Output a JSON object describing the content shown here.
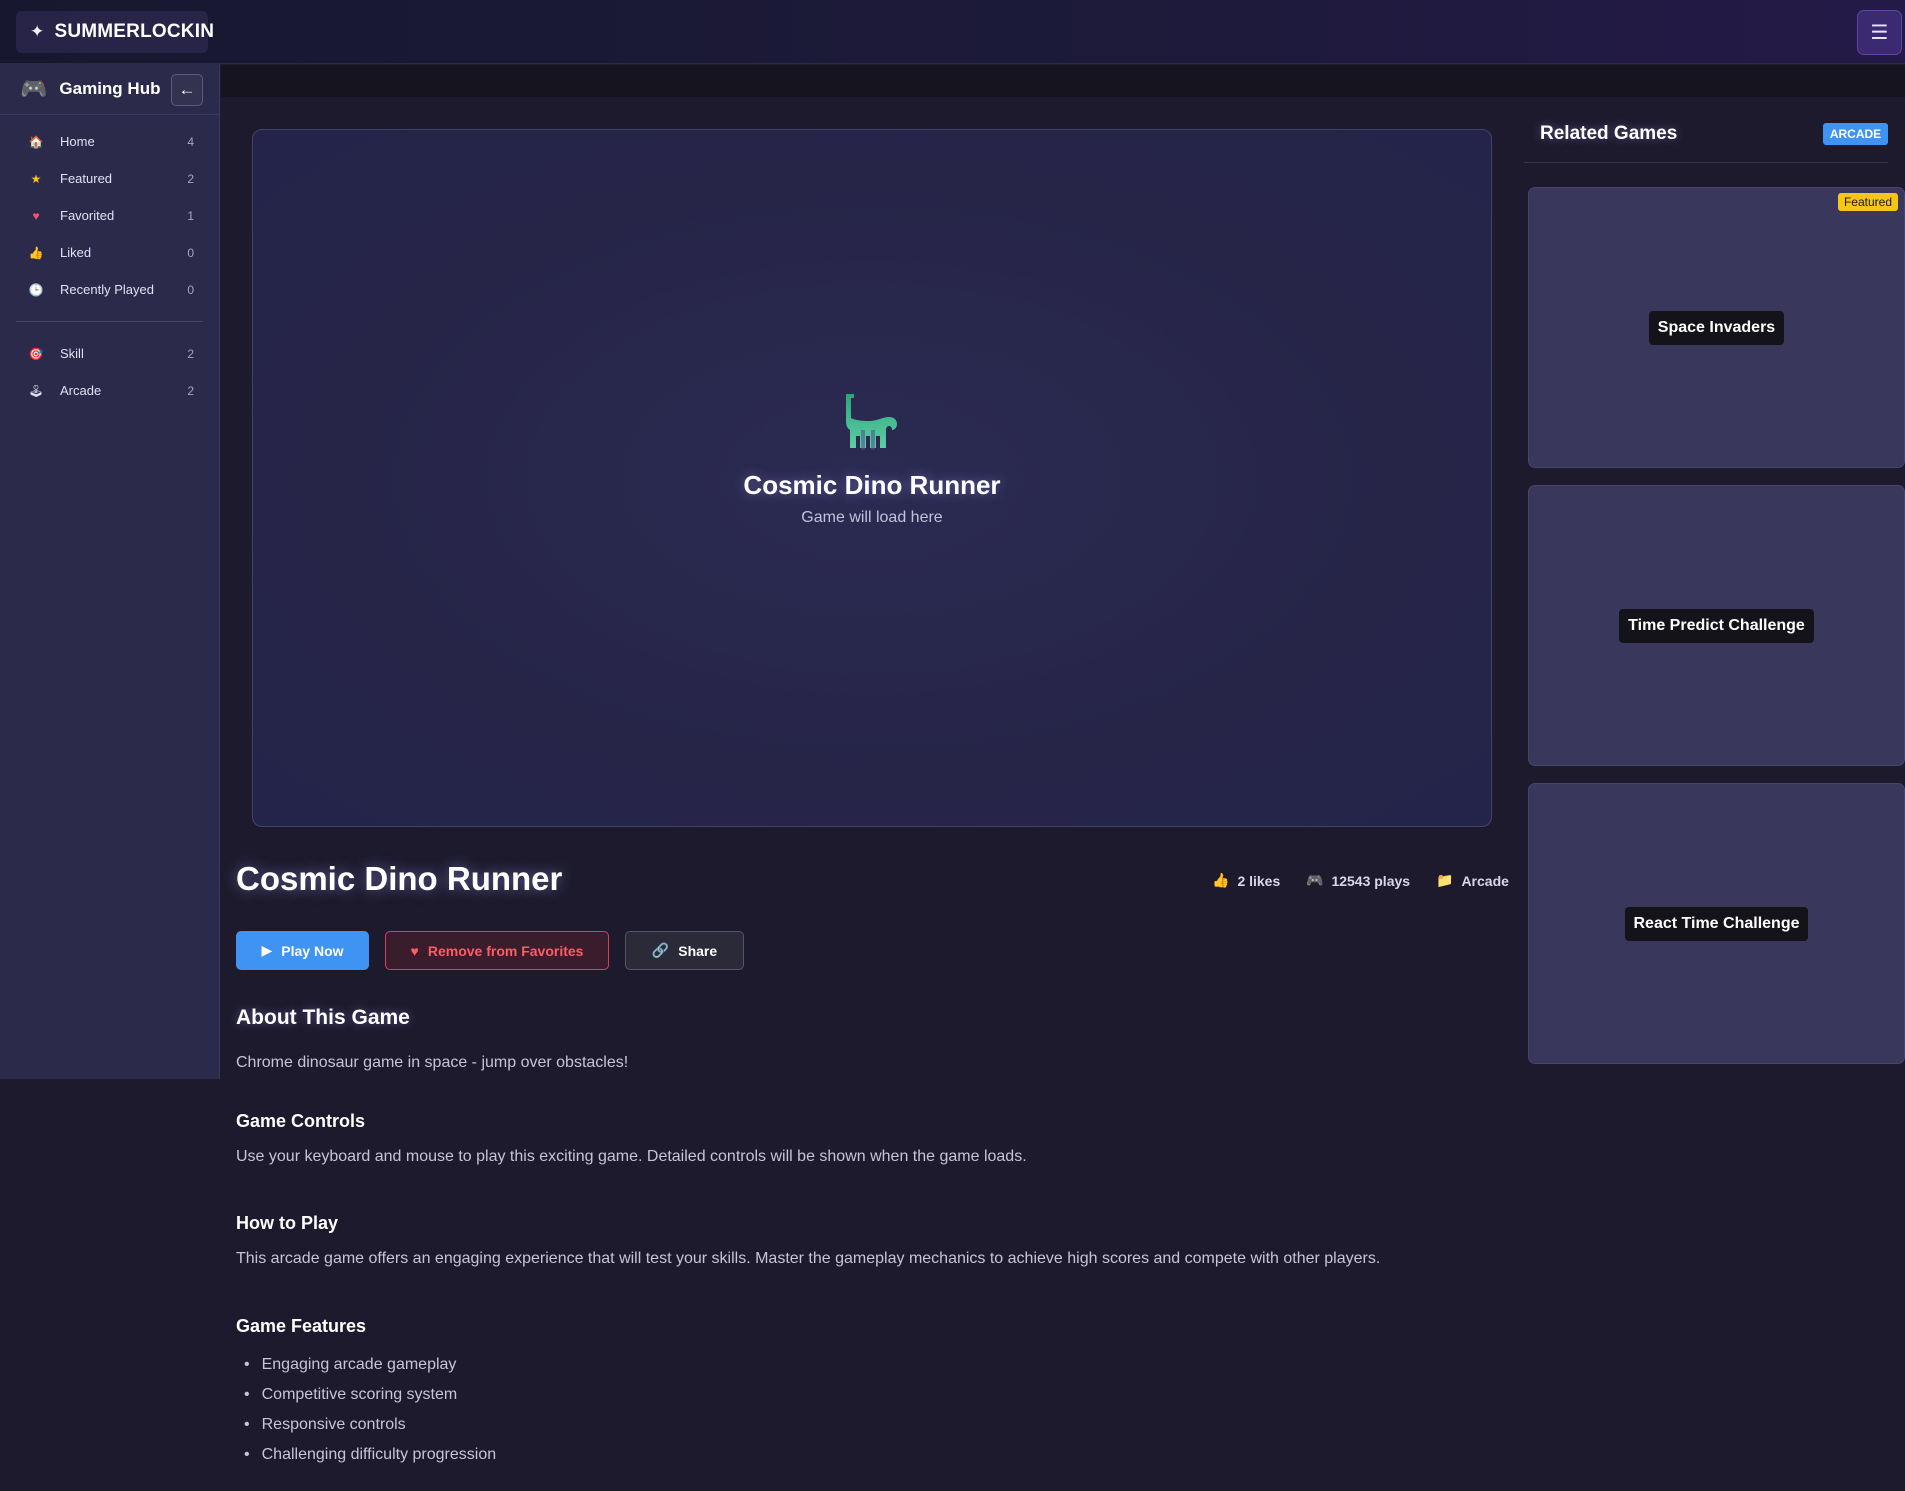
{
  "topbar": {
    "brand": "SUMMERLOCKIN",
    "brand_icon": "sparkle-icon",
    "menu_icon": "☰"
  },
  "sidebar": {
    "title": "Gaming Hub",
    "collapse_label": "←",
    "items": [
      {
        "label": "Home",
        "count": "4",
        "icon": "home-icon"
      },
      {
        "label": "Featured",
        "count": "2",
        "icon": "star-icon"
      },
      {
        "label": "Favorited",
        "count": "1",
        "icon": "heart-icon"
      },
      {
        "label": "Liked",
        "count": "0",
        "icon": "thumbs-up-icon"
      },
      {
        "label": "Recently Played",
        "count": "0",
        "icon": "clock-icon"
      }
    ],
    "categories": [
      {
        "label": "Skill",
        "count": "2",
        "icon": "target-icon"
      },
      {
        "label": "Arcade",
        "count": "2",
        "icon": "joystick-icon"
      }
    ]
  },
  "game_frame": {
    "title": "Cosmic Dino Runner",
    "subtitle": "Game will load here",
    "icon": "dinosaur-icon"
  },
  "game": {
    "title": "Cosmic Dino Runner",
    "likes": "2 likes",
    "plays": "12543 plays",
    "category": "Arcade"
  },
  "actions": {
    "play": "Play Now",
    "favorite": "Remove from Favorites",
    "share": "Share"
  },
  "about": {
    "heading": "About This Game",
    "description": "Chrome dinosaur game in space - jump over obstacles!",
    "controls_heading": "Game Controls",
    "controls_text": "Use your keyboard and mouse to play this exciting game. Detailed controls will be shown when the game loads.",
    "howto_heading": "How to Play",
    "howto_text": "This arcade game offers an engaging experience that will test your skills. Master the gameplay mechanics to achieve high scores and compete with other players.",
    "features_heading": "Game Features",
    "features": [
      "Engaging arcade gameplay",
      "Competitive scoring system",
      "Responsive controls",
      "Challenging difficulty progression"
    ]
  },
  "related": {
    "title": "Related Games",
    "badge": "ARCADE",
    "games": [
      {
        "label": "Space Invaders",
        "badge": "Featured"
      },
      {
        "label": "Time Predict Challenge"
      },
      {
        "label": "React Time Challenge"
      }
    ]
  },
  "colors": {
    "accent": "#3f93f2",
    "danger": "#ff5c66",
    "featured": "#f5c518",
    "dino": "#3fb88a"
  }
}
